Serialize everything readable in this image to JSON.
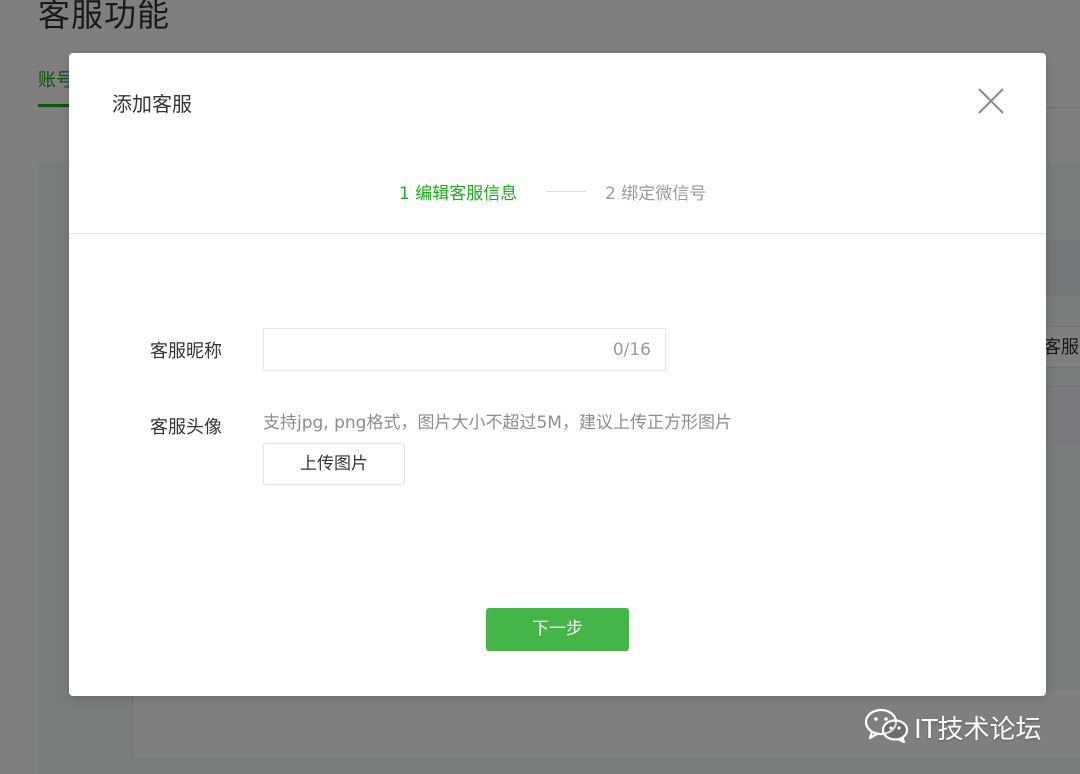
{
  "background": {
    "page_title": "客服功能",
    "tab_label": "账号",
    "row_action_label": "客服"
  },
  "dialog": {
    "title": "添加客服",
    "close_icon": "close-icon",
    "steps": {
      "active": "1 编辑客服信息",
      "inactive": "2 绑定微信号"
    },
    "form": {
      "nickname_label": "客服昵称",
      "nickname_value": "",
      "nickname_counter": "0/16",
      "avatar_label": "客服头像",
      "avatar_hint": "支持jpg, png格式，图片大小不超过5M，建议上传正方形图片",
      "upload_label": "上传图片"
    },
    "next_label": "下一步"
  },
  "watermark": {
    "logo_icon": "wechat-logo-icon",
    "text": "IT技术论坛"
  },
  "colors": {
    "brand_green": "#1aad19",
    "button_green": "#44b549",
    "mask": "rgba(0,0,0,0.5)"
  }
}
